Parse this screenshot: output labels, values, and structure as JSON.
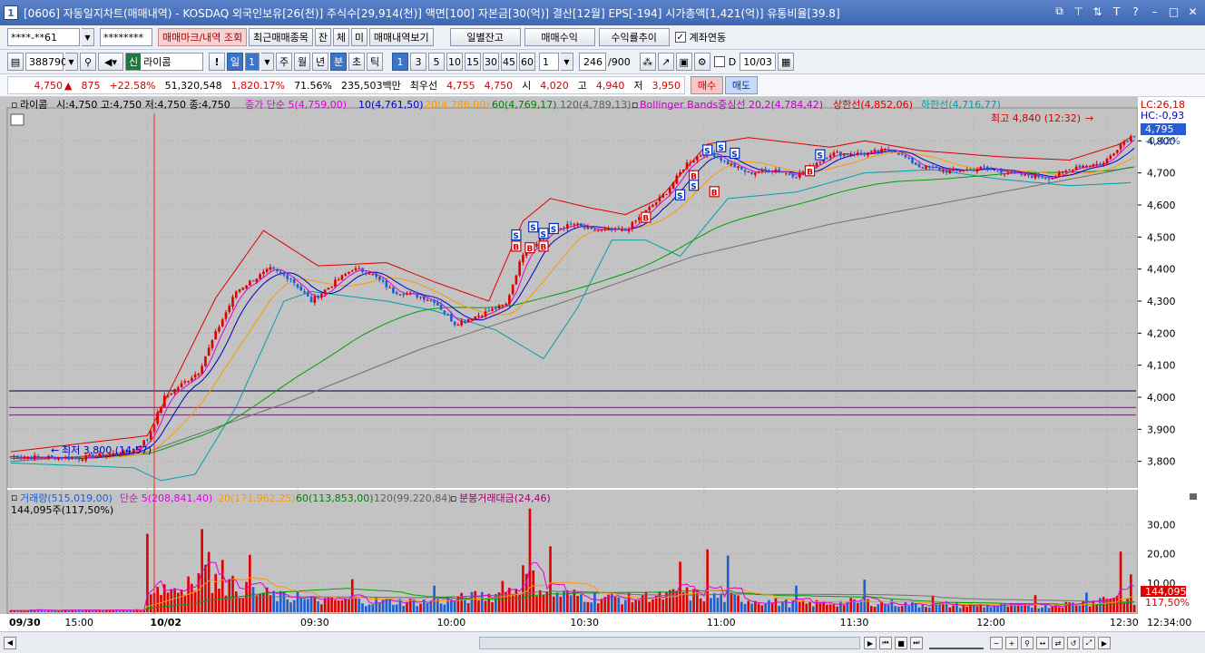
{
  "window": {
    "number": "1",
    "title": "[0606] 자동일지차트(매매내역) - KOSDAQ 외국인보유[26(천)] 주식수[29,914(천)] 액면[100] 자본금[30(억)] 결산[12월] EPS[-194] 시가총액[1,421(억)] 유통비율[39.8]"
  },
  "toolbar1": {
    "account": "****-**61",
    "password": "********",
    "trade_mark_btn": "매매마크/내역 조회",
    "recent_btn": "최근매매종목",
    "jan": "잔",
    "che": "체",
    "mi": "미",
    "history_btn": "매매내역보기",
    "daily_balance_btn": "일별잔고",
    "trade_profit_btn": "매매수익",
    "return_btn": "수익률추이",
    "link_checkbox": "계좌연동"
  },
  "toolbar2": {
    "code": "388790",
    "name_badge": "신",
    "name": "라이콤",
    "period_day": "일",
    "period_day_n": "1",
    "week": "주",
    "month": "월",
    "year": "년",
    "minute": "분",
    "second": "초",
    "tick": "틱",
    "intervals": [
      "1",
      "3",
      "5",
      "10",
      "15",
      "30",
      "45",
      "60"
    ],
    "count": "1",
    "range": "246",
    "range_max": "/900",
    "d_label": "D",
    "date": "10/03"
  },
  "quote": {
    "price": "4,750",
    "change": "875",
    "rate": "+22.58%",
    "volume": "51,320,548",
    "vol_rate": "1,820.17%",
    "turnover": "71.56%",
    "amount": "235,503백만",
    "ask_label": "최우선",
    "ask": "4,755",
    "bid": "4,750",
    "open_label": "시",
    "open": "4,020",
    "high_label": "고",
    "high": "4,940",
    "low_label": "저",
    "low": "3,950",
    "buy_btn": "매수",
    "sell_btn": "매도"
  },
  "price_legend": {
    "name": "라이콤",
    "ohlc": "시:4,750 고:4,750 저:4,750 종:4,750",
    "ma5": "종가 단순 5(4,759,00)",
    "ma10": "10(4,761,50)",
    "ma20": "20(4,786,00)",
    "ma60": "60(4,769,17)",
    "ma120": "120(4,789,13)",
    "bb_mid": "Bollinger Bands중심선 20,2(4,784,42)",
    "bb_upper": "상한선(4,852,06)",
    "bb_lower": "하한선(4,716,77)"
  },
  "volume_legend": {
    "vol": "거래량(515,019,00)",
    "ma5": "단순 5(208,841,40)",
    "ma20": "20(171,962,25)",
    "ma60": "60(113,853,00)",
    "ma120": "120(99,220,84)",
    "amount": "분봉거래대금(24,46)",
    "current": "144,095주(117,50%)"
  },
  "annotations": {
    "high_note": "최고 4,840 (12:32)",
    "low_note": "최저 3,800 (14:57)",
    "lc": "LC:26,18",
    "hc": "HC:-0,93",
    "price_tag": "4,795",
    "pct_tag": "-0,42%",
    "vol_tag": "144,095",
    "vol_pct_tag": "117,50%"
  },
  "colors": {
    "up": "#e00000",
    "down": "#1f5fd0",
    "ma5": "#e000e0",
    "ma10": "#0000c8",
    "ma20": "#ff9900",
    "ma60": "#00a000",
    "ma120": "#707070",
    "bb_upper": "#dd0000",
    "bb_lower": "#00a0a8",
    "background": "#c3c3c3"
  },
  "chart_data": {
    "type": "candlestick",
    "y_ticks": [
      "4,800",
      "4,700",
      "4,600",
      "4,500",
      "4,400",
      "4,300",
      "4,200",
      "4,100",
      "4,000",
      "3,900",
      "3,800"
    ],
    "y_tick_values": [
      4800,
      4700,
      4600,
      4500,
      4400,
      4300,
      4200,
      4100,
      4000,
      3900,
      3800
    ],
    "ylim": [
      3720,
      4880
    ],
    "x_ticks": [
      "09/30",
      "15:00",
      "10/02",
      "09:30",
      "10:00",
      "10:30",
      "11:00",
      "11:30",
      "12:00",
      "12:30"
    ],
    "x_tick_index": [
      0,
      15,
      40,
      84,
      124,
      163,
      203,
      242,
      282,
      321
    ],
    "last_time": "12:34:00",
    "bar_count": 330,
    "h_lines": [
      4020,
      3968,
      3945
    ],
    "close_path": [
      [
        0,
        3815
      ],
      [
        20,
        3810
      ],
      [
        35,
        3830
      ],
      [
        40,
        3870
      ],
      [
        45,
        4000
      ],
      [
        55,
        4080
      ],
      [
        60,
        4200
      ],
      [
        66,
        4330
      ],
      [
        70,
        4360
      ],
      [
        76,
        4400
      ],
      [
        82,
        4370
      ],
      [
        88,
        4300
      ],
      [
        95,
        4360
      ],
      [
        100,
        4400
      ],
      [
        105,
        4390
      ],
      [
        112,
        4330
      ],
      [
        118,
        4320
      ],
      [
        124,
        4300
      ],
      [
        130,
        4230
      ],
      [
        138,
        4260
      ],
      [
        145,
        4290
      ],
      [
        150,
        4450
      ],
      [
        158,
        4520
      ],
      [
        165,
        4540
      ],
      [
        170,
        4520
      ],
      [
        180,
        4520
      ],
      [
        186,
        4580
      ],
      [
        192,
        4640
      ],
      [
        198,
        4730
      ],
      [
        204,
        4770
      ],
      [
        210,
        4730
      ],
      [
        216,
        4700
      ],
      [
        224,
        4710
      ],
      [
        230,
        4690
      ],
      [
        240,
        4760
      ],
      [
        250,
        4760
      ],
      [
        258,
        4775
      ],
      [
        266,
        4720
      ],
      [
        275,
        4705
      ],
      [
        285,
        4715
      ],
      [
        295,
        4695
      ],
      [
        305,
        4685
      ],
      [
        312,
        4720
      ],
      [
        320,
        4730
      ],
      [
        325,
        4790
      ],
      [
        329,
        4820
      ]
    ],
    "ma120_path": [
      [
        0,
        3800
      ],
      [
        40,
        3830
      ],
      [
        80,
        3980
      ],
      [
        120,
        4150
      ],
      [
        160,
        4290
      ],
      [
        200,
        4440
      ],
      [
        240,
        4540
      ],
      [
        280,
        4620
      ],
      [
        320,
        4700
      ],
      [
        329,
        4720
      ]
    ],
    "bb_upper_path": [
      [
        0,
        3830
      ],
      [
        40,
        3880
      ],
      [
        60,
        4310
      ],
      [
        74,
        4520
      ],
      [
        90,
        4410
      ],
      [
        110,
        4420
      ],
      [
        124,
        4360
      ],
      [
        140,
        4300
      ],
      [
        150,
        4550
      ],
      [
        158,
        4620
      ],
      [
        170,
        4590
      ],
      [
        180,
        4570
      ],
      [
        190,
        4620
      ],
      [
        204,
        4790
      ],
      [
        216,
        4810
      ],
      [
        240,
        4780
      ],
      [
        250,
        4800
      ],
      [
        266,
        4770
      ],
      [
        290,
        4750
      ],
      [
        310,
        4740
      ],
      [
        325,
        4790
      ],
      [
        329,
        4820
      ]
    ],
    "bb_lower_path": [
      [
        0,
        3795
      ],
      [
        36,
        3780
      ],
      [
        44,
        3740
      ],
      [
        54,
        3760
      ],
      [
        66,
        3970
      ],
      [
        80,
        4300
      ],
      [
        88,
        4330
      ],
      [
        110,
        4300
      ],
      [
        124,
        4270
      ],
      [
        142,
        4210
      ],
      [
        156,
        4120
      ],
      [
        166,
        4280
      ],
      [
        176,
        4490
      ],
      [
        186,
        4490
      ],
      [
        196,
        4440
      ],
      [
        210,
        4620
      ],
      [
        230,
        4640
      ],
      [
        250,
        4700
      ],
      [
        270,
        4710
      ],
      [
        290,
        4680
      ],
      [
        310,
        4660
      ],
      [
        329,
        4670
      ]
    ],
    "volume_y_ticks": [
      "30,00",
      "20,00",
      "10,00"
    ],
    "volume_tick_values": [
      30,
      20,
      10
    ],
    "volume_max": 36,
    "volume_peaks": [
      [
        40,
        26
      ],
      [
        52,
        22
      ],
      [
        56,
        33
      ],
      [
        58,
        34
      ],
      [
        62,
        28
      ],
      [
        70,
        20
      ],
      [
        84,
        12
      ],
      [
        100,
        11
      ],
      [
        124,
        10
      ],
      [
        144,
        18
      ],
      [
        150,
        26
      ],
      [
        152,
        32
      ],
      [
        158,
        18
      ],
      [
        186,
        12
      ],
      [
        196,
        18
      ],
      [
        204,
        16
      ],
      [
        210,
        14
      ],
      [
        230,
        8
      ],
      [
        250,
        10
      ],
      [
        270,
        7
      ],
      [
        300,
        6
      ],
      [
        315,
        9
      ],
      [
        325,
        18
      ],
      [
        328,
        9
      ]
    ],
    "buy_marks": [
      [
        148,
        4470
      ],
      [
        152,
        4465
      ],
      [
        156,
        4470
      ],
      [
        186,
        4560
      ],
      [
        200,
        4690
      ],
      [
        206,
        4640
      ],
      [
        234,
        4705
      ]
    ],
    "sell_marks": [
      [
        148,
        4505
      ],
      [
        153,
        4530
      ],
      [
        156,
        4510
      ],
      [
        159,
        4525
      ],
      [
        196,
        4630
      ],
      [
        200,
        4660
      ],
      [
        204,
        4770
      ],
      [
        208,
        4780
      ],
      [
        212,
        4760
      ],
      [
        237,
        4755
      ]
    ]
  }
}
